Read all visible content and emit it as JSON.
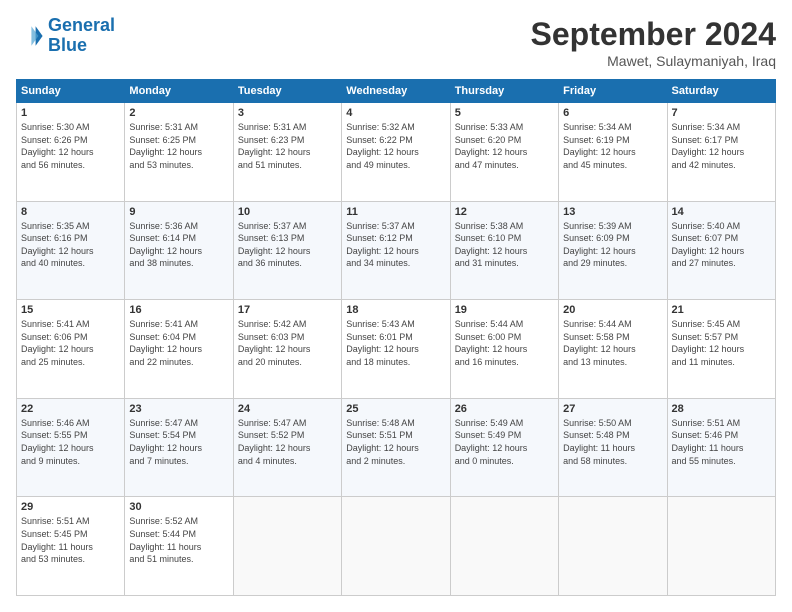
{
  "logo": {
    "line1": "General",
    "line2": "Blue"
  },
  "header": {
    "month": "September 2024",
    "location": "Mawet, Sulaymaniyah, Iraq"
  },
  "weekdays": [
    "Sunday",
    "Monday",
    "Tuesday",
    "Wednesday",
    "Thursday",
    "Friday",
    "Saturday"
  ],
  "weeks": [
    [
      {
        "day": "1",
        "info": "Sunrise: 5:30 AM\nSunset: 6:26 PM\nDaylight: 12 hours\nand 56 minutes."
      },
      {
        "day": "2",
        "info": "Sunrise: 5:31 AM\nSunset: 6:25 PM\nDaylight: 12 hours\nand 53 minutes."
      },
      {
        "day": "3",
        "info": "Sunrise: 5:31 AM\nSunset: 6:23 PM\nDaylight: 12 hours\nand 51 minutes."
      },
      {
        "day": "4",
        "info": "Sunrise: 5:32 AM\nSunset: 6:22 PM\nDaylight: 12 hours\nand 49 minutes."
      },
      {
        "day": "5",
        "info": "Sunrise: 5:33 AM\nSunset: 6:20 PM\nDaylight: 12 hours\nand 47 minutes."
      },
      {
        "day": "6",
        "info": "Sunrise: 5:34 AM\nSunset: 6:19 PM\nDaylight: 12 hours\nand 45 minutes."
      },
      {
        "day": "7",
        "info": "Sunrise: 5:34 AM\nSunset: 6:17 PM\nDaylight: 12 hours\nand 42 minutes."
      }
    ],
    [
      {
        "day": "8",
        "info": "Sunrise: 5:35 AM\nSunset: 6:16 PM\nDaylight: 12 hours\nand 40 minutes."
      },
      {
        "day": "9",
        "info": "Sunrise: 5:36 AM\nSunset: 6:14 PM\nDaylight: 12 hours\nand 38 minutes."
      },
      {
        "day": "10",
        "info": "Sunrise: 5:37 AM\nSunset: 6:13 PM\nDaylight: 12 hours\nand 36 minutes."
      },
      {
        "day": "11",
        "info": "Sunrise: 5:37 AM\nSunset: 6:12 PM\nDaylight: 12 hours\nand 34 minutes."
      },
      {
        "day": "12",
        "info": "Sunrise: 5:38 AM\nSunset: 6:10 PM\nDaylight: 12 hours\nand 31 minutes."
      },
      {
        "day": "13",
        "info": "Sunrise: 5:39 AM\nSunset: 6:09 PM\nDaylight: 12 hours\nand 29 minutes."
      },
      {
        "day": "14",
        "info": "Sunrise: 5:40 AM\nSunset: 6:07 PM\nDaylight: 12 hours\nand 27 minutes."
      }
    ],
    [
      {
        "day": "15",
        "info": "Sunrise: 5:41 AM\nSunset: 6:06 PM\nDaylight: 12 hours\nand 25 minutes."
      },
      {
        "day": "16",
        "info": "Sunrise: 5:41 AM\nSunset: 6:04 PM\nDaylight: 12 hours\nand 22 minutes."
      },
      {
        "day": "17",
        "info": "Sunrise: 5:42 AM\nSunset: 6:03 PM\nDaylight: 12 hours\nand 20 minutes."
      },
      {
        "day": "18",
        "info": "Sunrise: 5:43 AM\nSunset: 6:01 PM\nDaylight: 12 hours\nand 18 minutes."
      },
      {
        "day": "19",
        "info": "Sunrise: 5:44 AM\nSunset: 6:00 PM\nDaylight: 12 hours\nand 16 minutes."
      },
      {
        "day": "20",
        "info": "Sunrise: 5:44 AM\nSunset: 5:58 PM\nDaylight: 12 hours\nand 13 minutes."
      },
      {
        "day": "21",
        "info": "Sunrise: 5:45 AM\nSunset: 5:57 PM\nDaylight: 12 hours\nand 11 minutes."
      }
    ],
    [
      {
        "day": "22",
        "info": "Sunrise: 5:46 AM\nSunset: 5:55 PM\nDaylight: 12 hours\nand 9 minutes."
      },
      {
        "day": "23",
        "info": "Sunrise: 5:47 AM\nSunset: 5:54 PM\nDaylight: 12 hours\nand 7 minutes."
      },
      {
        "day": "24",
        "info": "Sunrise: 5:47 AM\nSunset: 5:52 PM\nDaylight: 12 hours\nand 4 minutes."
      },
      {
        "day": "25",
        "info": "Sunrise: 5:48 AM\nSunset: 5:51 PM\nDaylight: 12 hours\nand 2 minutes."
      },
      {
        "day": "26",
        "info": "Sunrise: 5:49 AM\nSunset: 5:49 PM\nDaylight: 12 hours\nand 0 minutes."
      },
      {
        "day": "27",
        "info": "Sunrise: 5:50 AM\nSunset: 5:48 PM\nDaylight: 11 hours\nand 58 minutes."
      },
      {
        "day": "28",
        "info": "Sunrise: 5:51 AM\nSunset: 5:46 PM\nDaylight: 11 hours\nand 55 minutes."
      }
    ],
    [
      {
        "day": "29",
        "info": "Sunrise: 5:51 AM\nSunset: 5:45 PM\nDaylight: 11 hours\nand 53 minutes."
      },
      {
        "day": "30",
        "info": "Sunrise: 5:52 AM\nSunset: 5:44 PM\nDaylight: 11 hours\nand 51 minutes."
      },
      {
        "day": "",
        "info": ""
      },
      {
        "day": "",
        "info": ""
      },
      {
        "day": "",
        "info": ""
      },
      {
        "day": "",
        "info": ""
      },
      {
        "day": "",
        "info": ""
      }
    ]
  ]
}
